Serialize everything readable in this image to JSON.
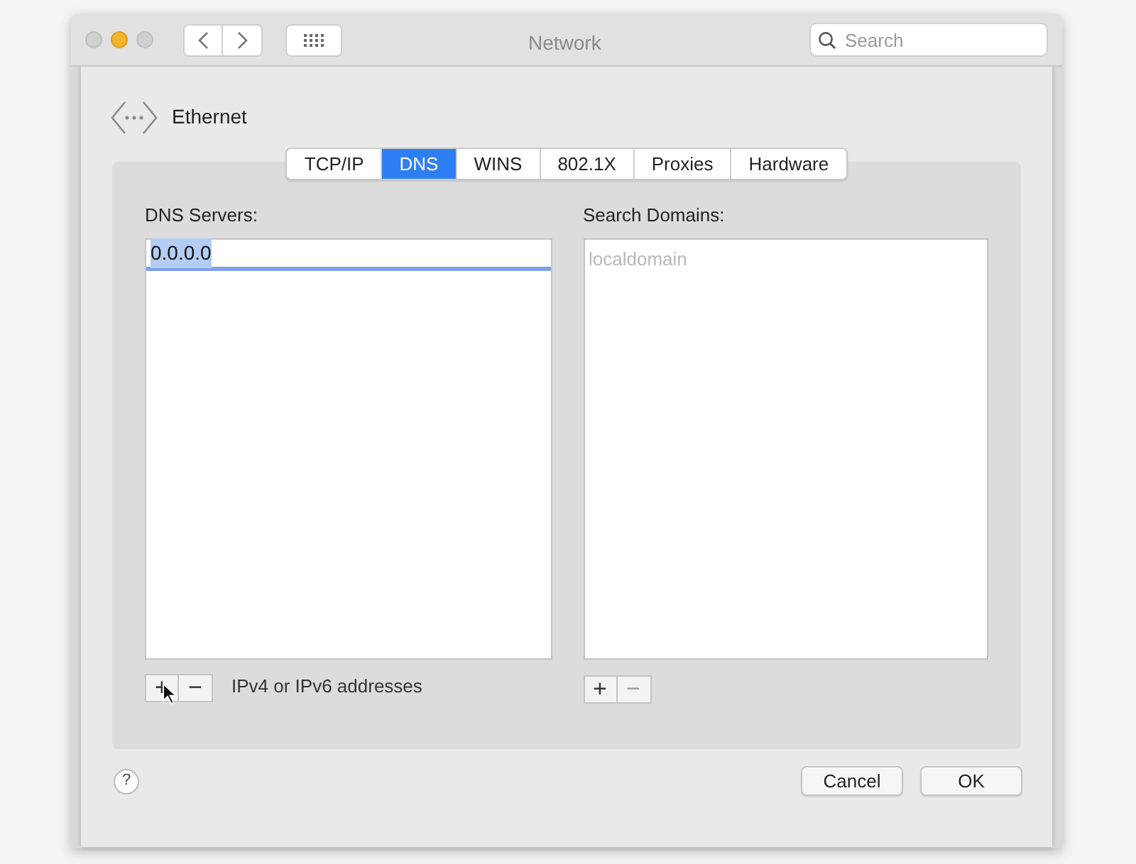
{
  "window": {
    "title": "Network"
  },
  "toolbar": {
    "search": {
      "placeholder": "Search"
    }
  },
  "interface": {
    "name": "Ethernet"
  },
  "tabs": [
    {
      "label": "TCP/IP",
      "selected": false
    },
    {
      "label": "DNS",
      "selected": true
    },
    {
      "label": "WINS",
      "selected": false
    },
    {
      "label": "802.1X",
      "selected": false
    },
    {
      "label": "Proxies",
      "selected": false
    },
    {
      "label": "Hardware",
      "selected": false
    }
  ],
  "dns_servers": {
    "label": "DNS Servers:",
    "entries": [
      {
        "text": "0.0.0.0",
        "selected": true
      }
    ],
    "buttons": [
      {
        "label": "+",
        "disabled": false
      },
      {
        "label": "−",
        "disabled": false
      }
    ],
    "hint": "IPv4 or IPv6 addresses"
  },
  "search_domains": {
    "label": "Search Domains:",
    "placeholder": "localdomain",
    "buttons": [
      {
        "label": "+",
        "disabled": false
      },
      {
        "label": "−",
        "disabled": true
      }
    ]
  },
  "footer": {
    "help": "?",
    "buttons": [
      "Cancel",
      "OK"
    ]
  }
}
